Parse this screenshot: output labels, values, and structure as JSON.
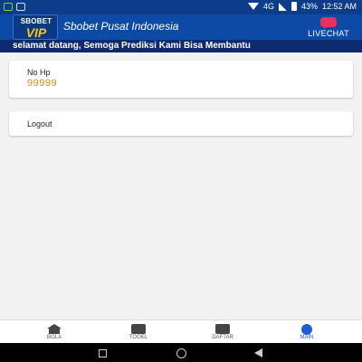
{
  "status_bar": {
    "time": "12:52 AM",
    "battery_text": "43%",
    "battery_level": 0.43,
    "network_label": "4G"
  },
  "header": {
    "logo_text_top": "SBOBET",
    "logo_text_bottom": "VIP",
    "title": "Sbobet Pusat Indonesia",
    "livechat_label": "LIVECHAT"
  },
  "marquee": {
    "text": "selamat datang, Semoga Prediksi Kami Bisa Membantu"
  },
  "profile": {
    "phone_label": "No Hp",
    "phone_value": "99999",
    "logout_label": "Logout"
  },
  "bottom_nav": {
    "items": [
      {
        "label": "BOLA",
        "icon": "home-icon"
      },
      {
        "label": "TOGEL",
        "icon": "list-icon"
      },
      {
        "label": "DAFTAR",
        "icon": "calendar-icon"
      },
      {
        "label": "MAIN",
        "icon": "user-icon"
      }
    ],
    "active": "MAIN"
  },
  "colors": {
    "primary": "#0d4aa6",
    "marquee_bg": "#0e2a6e",
    "accent_value": "#d28a1c",
    "active_nav": "#1e5bd6"
  }
}
